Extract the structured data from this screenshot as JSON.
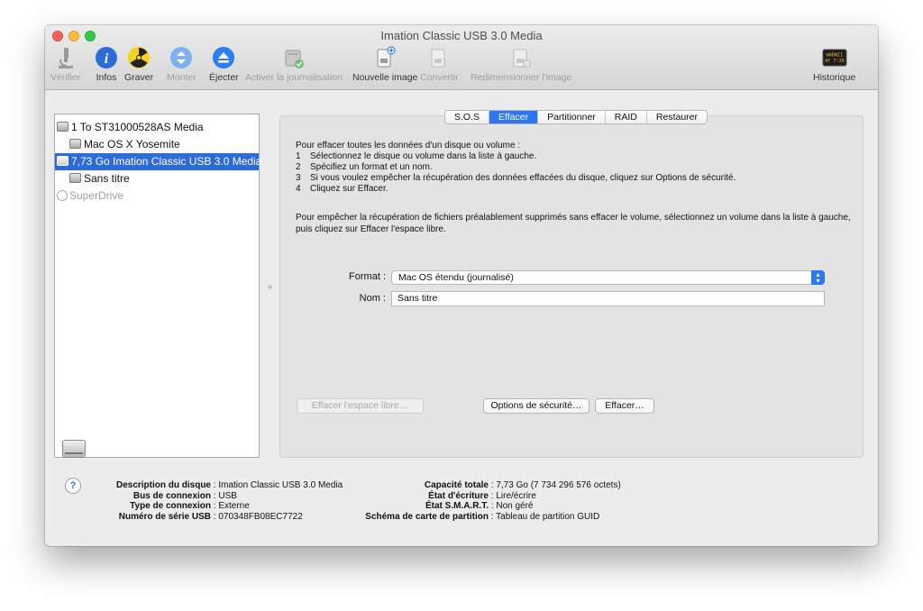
{
  "window": {
    "title": "Imation Classic USB 3.0 Media"
  },
  "toolbar": {
    "items": [
      {
        "label": "Vérifier",
        "icon": "microscope-icon",
        "enabled": false
      },
      {
        "label": "Infos",
        "icon": "info-icon",
        "enabled": true
      },
      {
        "label": "Graver",
        "icon": "burn-icon",
        "enabled": true
      },
      {
        "label": "Monter",
        "icon": "mount-icon",
        "enabled": false
      },
      {
        "label": "Éjecter",
        "icon": "eject-icon",
        "enabled": true
      },
      {
        "label": "Activer la journalisation",
        "icon": "journal-icon",
        "enabled": false
      },
      {
        "label": "Nouvelle image",
        "icon": "new-image-icon",
        "enabled": true
      },
      {
        "label": "Convertir",
        "icon": "convert-icon",
        "enabled": false
      },
      {
        "label": "Redimensionner l'image",
        "icon": "resize-image-icon",
        "enabled": false
      },
      {
        "label": "Historique",
        "icon": "log-icon",
        "enabled": true
      }
    ],
    "log_icon_text": [
      "WARNII",
      "AY 7:36"
    ]
  },
  "sidebar": {
    "items": [
      {
        "label": "1 To ST31000528AS Media",
        "level": 0,
        "selected": false,
        "dim": false
      },
      {
        "label": "Mac OS X Yosemite",
        "level": 1,
        "selected": false,
        "dim": false
      },
      {
        "label": "7,73 Go Imation Classic USB 3.0 Media",
        "level": 0,
        "selected": true,
        "dim": false
      },
      {
        "label": "Sans titre",
        "level": 1,
        "selected": false,
        "dim": false
      },
      {
        "label": "SuperDrive",
        "level": 0,
        "selected": false,
        "dim": true
      }
    ]
  },
  "tabs": [
    {
      "label": "S.O.S",
      "active": false
    },
    {
      "label": "Effacer",
      "active": true
    },
    {
      "label": "Partitionner",
      "active": false
    },
    {
      "label": "RAID",
      "active": false
    },
    {
      "label": "Restaurer",
      "active": false
    }
  ],
  "erase": {
    "intro": "Pour effacer toutes les données d'un disque ou volume :",
    "steps": [
      {
        "num": "1",
        "text": "Sélectionnez le disque ou volume dans la liste à gauche."
      },
      {
        "num": "2",
        "text": "Spécifiez un format et un nom."
      },
      {
        "num": "3",
        "text": "Si vous voulez empêcher la récupération des données effacées du disque, cliquez sur Options de sécurité."
      },
      {
        "num": "4",
        "text": "Cliquez sur Effacer."
      }
    ],
    "paragraph": "Pour empêcher la récupération de fichiers préalablement supprimés sans effacer le volume, sélectionnez un volume dans la liste à gauche, puis cliquez sur Effacer l'espace libre.",
    "format_label": "Format :",
    "format_value": "Mac OS étendu (journalisé)",
    "name_label": "Nom :",
    "name_value": "Sans titre",
    "btn_free_space": "Effacer l'espace libre…",
    "btn_security": "Options de sécurité…",
    "btn_erase": "Effacer…"
  },
  "info": {
    "left": [
      {
        "key": "Description du disque",
        "value": "Imation Classic USB 3.0 Media"
      },
      {
        "key": "Bus de connexion",
        "value": "USB"
      },
      {
        "key": "Type de connexion",
        "value": "Externe"
      },
      {
        "key": "Numéro de série USB",
        "value": "070348FB08EC7722"
      }
    ],
    "right": [
      {
        "key": "Capacité totale",
        "value": "7,73 Go (7 734 296 576 octets)"
      },
      {
        "key": "État d'écriture",
        "value": "Lire/écrire"
      },
      {
        "key": "État S.M.A.R.T.",
        "value": "Non géré"
      },
      {
        "key": "Schéma de carte de partition",
        "value": "Tableau de partition GUID"
      }
    ],
    "help_label": "?"
  },
  "colors": {
    "selection": "#2d6cd8",
    "accent": "#2a76f3"
  }
}
